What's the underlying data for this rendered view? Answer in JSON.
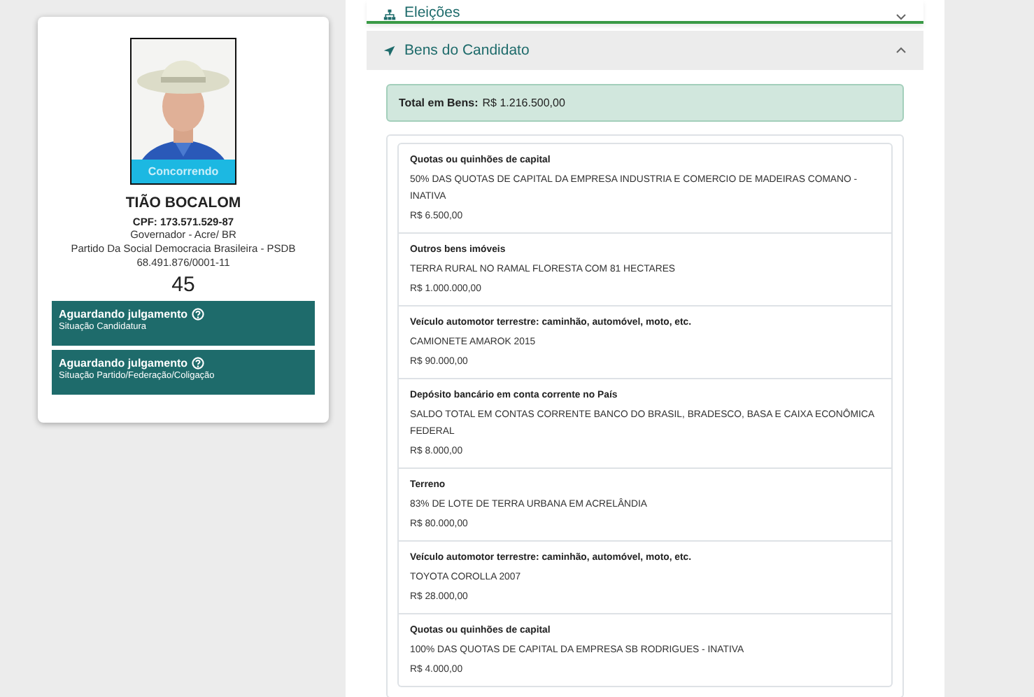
{
  "candidate": {
    "status_badge": "Concorrendo",
    "name": "TIÃO BOCALOM",
    "cpf": "CPF: 173.571.529-87",
    "office": "Governador - Acre/ BR",
    "party": "Partido Da Social Democracia Brasileira - PSDB",
    "cnpj": "68.491.876/0001-11",
    "number": "45",
    "situations": [
      {
        "title": "Aguardando julgamento",
        "subtitle": "Situação Candidatura"
      },
      {
        "title": "Aguardando julgamento",
        "subtitle": "Situação Partido/Federação/Coligação"
      }
    ]
  },
  "sections": [
    {
      "title": "Eleições",
      "expanded": false
    },
    {
      "title": "Bens do Candidato",
      "expanded": true
    }
  ],
  "assets": {
    "total_label": "Total em Bens:",
    "total_value": "R$ 1.216.500,00",
    "items": [
      {
        "type": "Quotas ou quinhões de capital",
        "description": "50% DAS QUOTAS DE CAPITAL DA EMPRESA INDUSTRIA E COMERCIO DE MADEIRAS COMANO - INATIVA",
        "value": "R$ 6.500,00"
      },
      {
        "type": "Outros bens imóveis",
        "description": "TERRA RURAL NO RAMAL FLORESTA COM 81 HECTARES",
        "value": "R$ 1.000.000,00"
      },
      {
        "type": "Veículo automotor terrestre: caminhão, automóvel, moto, etc.",
        "description": "CAMIONETE AMAROK 2015",
        "value": "R$ 90.000,00"
      },
      {
        "type": "Depósito bancário em conta corrente no País",
        "description": "SALDO TOTAL EM CONTAS CORRENTE BANCO DO BRASIL, BRADESCO, BASA E CAIXA ECONÔMICA FEDERAL",
        "value": "R$ 8.000,00"
      },
      {
        "type": "Terreno",
        "description": "83% DE LOTE DE TERRA URBANA EM ACRELÂNDIA",
        "value": "R$ 80.000,00"
      },
      {
        "type": "Veículo automotor terrestre: caminhão, automóvel, moto, etc.",
        "description": "TOYOTA COROLLA 2007",
        "value": "R$ 28.000,00"
      },
      {
        "type": "Quotas ou quinhões de capital",
        "description": "100% DAS QUOTAS DE CAPITAL DA EMPRESA SB RODRIGUES - INATIVA",
        "value": "R$ 4.000,00"
      }
    ]
  }
}
